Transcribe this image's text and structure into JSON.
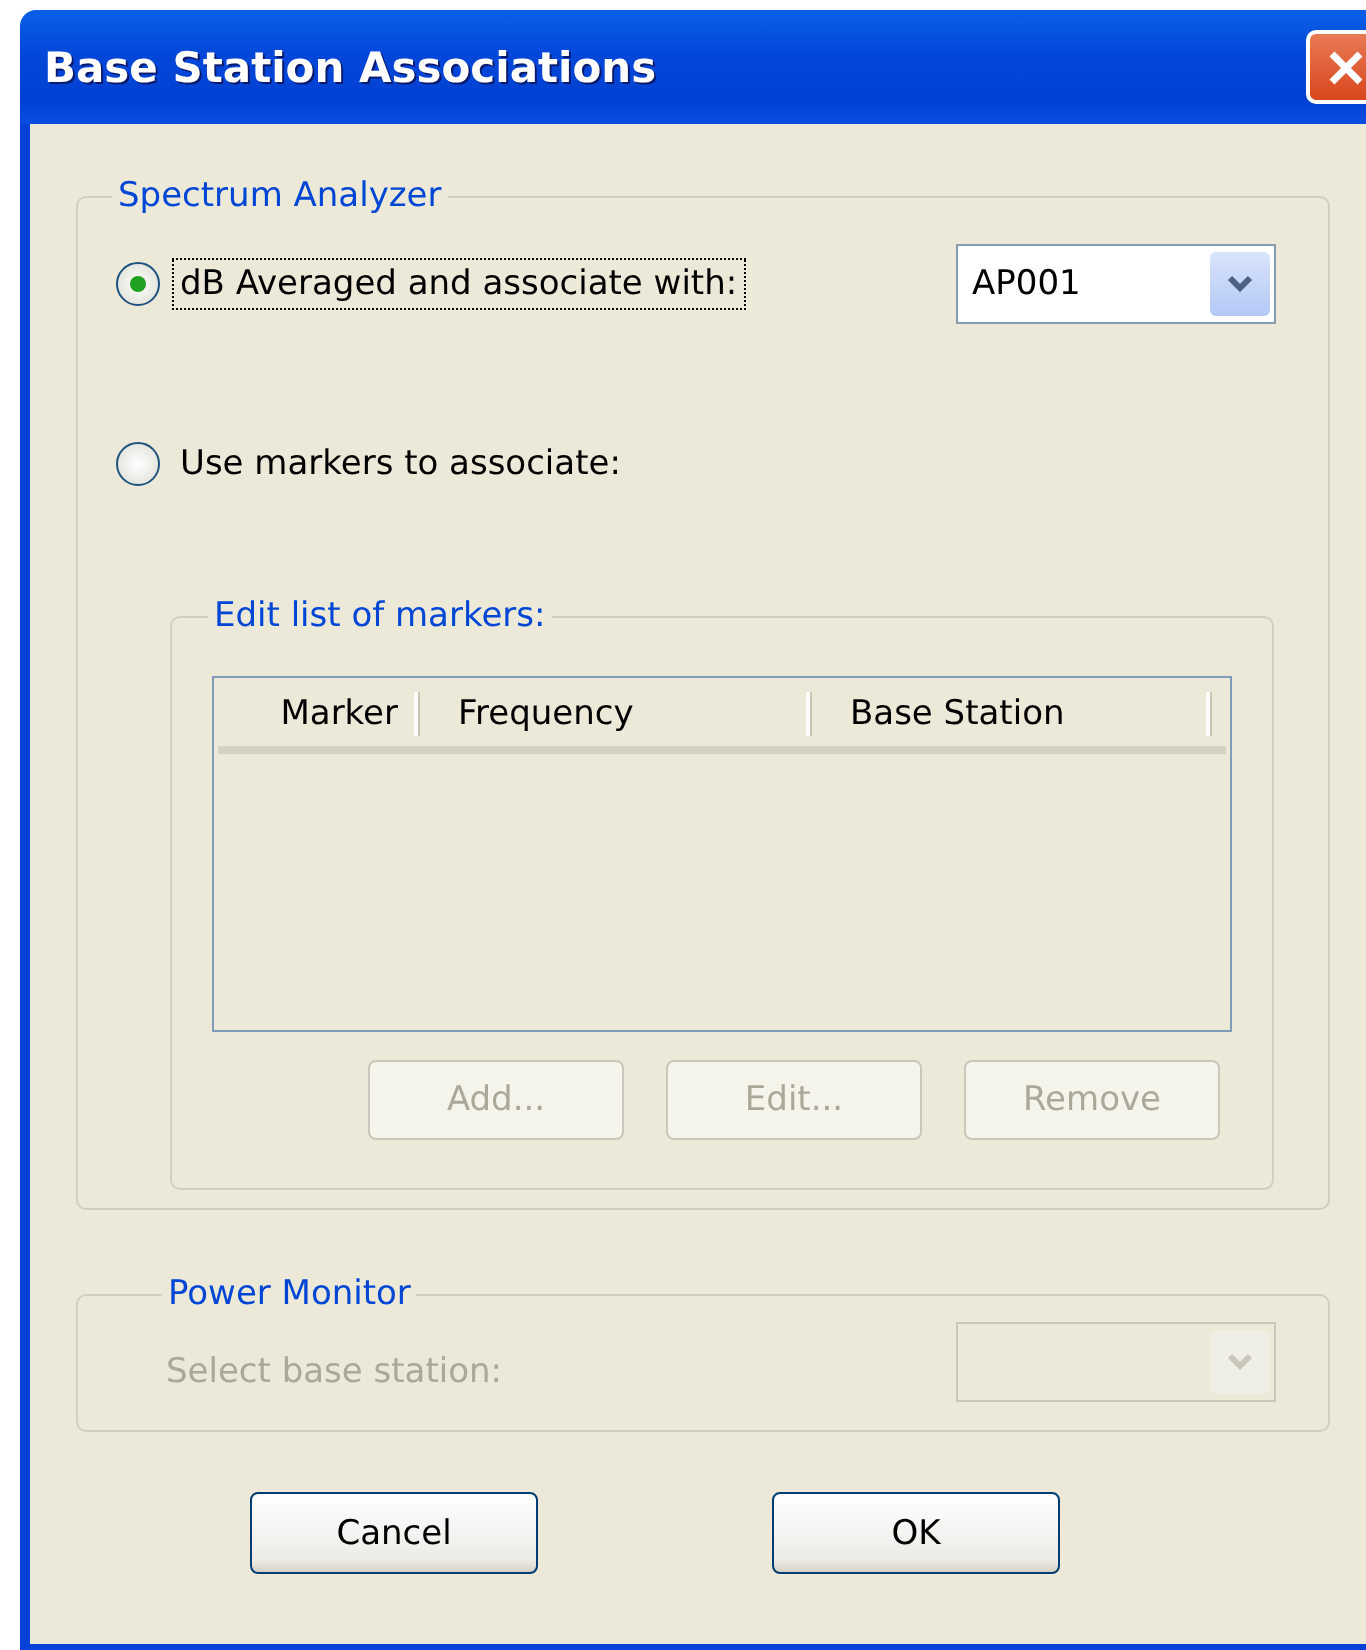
{
  "window": {
    "title": "Base Station Associations"
  },
  "spectrum_analyzer": {
    "label": "Spectrum Analyzer",
    "options": [
      {
        "label": "dB Averaged and associate with:",
        "selected": true,
        "focused": true
      },
      {
        "label": "Use markers to associate:",
        "selected": false,
        "focused": false
      }
    ],
    "base_station_select": {
      "value": "AP001",
      "disabled": false
    },
    "markers": {
      "label": "Edit list of markers:",
      "columns": [
        "Marker",
        "Frequency",
        "Base Station"
      ],
      "buttons": [
        {
          "label": "Add...",
          "disabled": true
        },
        {
          "label": "Edit...",
          "disabled": true
        },
        {
          "label": "Remove",
          "disabled": true
        }
      ]
    }
  },
  "power_monitor": {
    "label": "Power Monitor",
    "field_label": "Select base station:",
    "disabled": true,
    "select": {
      "disabled": true
    }
  },
  "buttons": [
    {
      "label": "Cancel",
      "disabled": false
    },
    {
      "label": "OK",
      "disabled": false
    }
  ]
}
